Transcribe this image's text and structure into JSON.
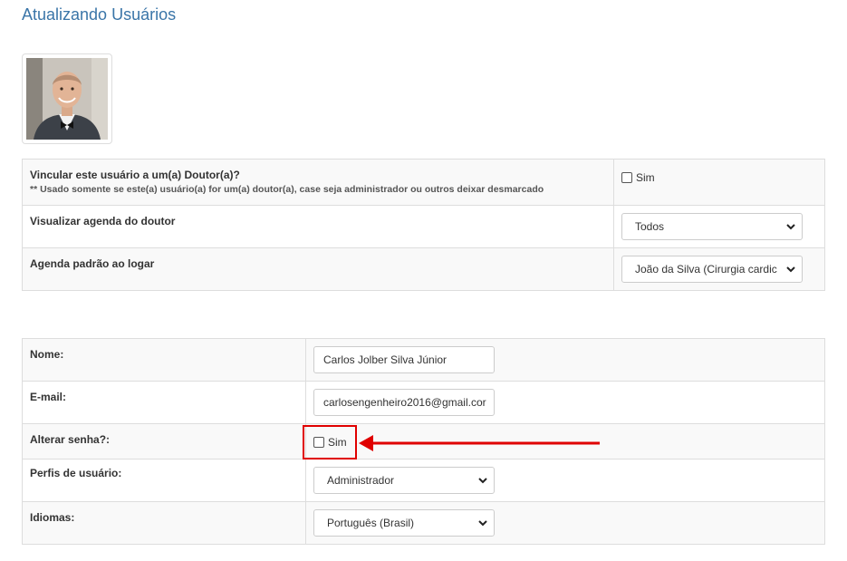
{
  "page": {
    "title": "Atualizando Usuários"
  },
  "avatar": {
    "alt": "user-photo"
  },
  "doctor_section": {
    "link_label": "Vincular este usuário a um(a) Doutor(a)?",
    "link_note": "** Usado somente se este(a) usuário(a) for um(a) doutor(a), case seja administrador ou outros deixar desmarcado",
    "link_checkbox_label": "Sim",
    "link_checked": false,
    "view_agenda_label": "Visualizar agenda do doutor",
    "view_agenda_value": "Todos",
    "default_agenda_label": "Agenda padrão ao logar",
    "default_agenda_value": "João da Silva (Cirurgia cardic"
  },
  "user_form": {
    "name_label": "Nome:",
    "name_value": "Carlos Jolber Silva Júnior",
    "email_label": "E-mail:",
    "email_value": "carlosengenheiro2016@gmail.cor",
    "change_password_label": "Alterar senha?:",
    "change_password_checkbox_label": "Sim",
    "change_password_checked": false,
    "profile_label": "Perfis de usuário:",
    "profile_value": "Administrador",
    "language_label": "Idiomas:",
    "language_value": "Português (Brasil)"
  },
  "annotation": {
    "color": "#e00000"
  },
  "colors": {
    "title": "#3a75a8",
    "border": "#dddddd",
    "row_stripe": "#f9f9f9"
  },
  "icons": {
    "select_arrow": "chevron-down-icon",
    "pointer": "red-arrow-icon"
  }
}
